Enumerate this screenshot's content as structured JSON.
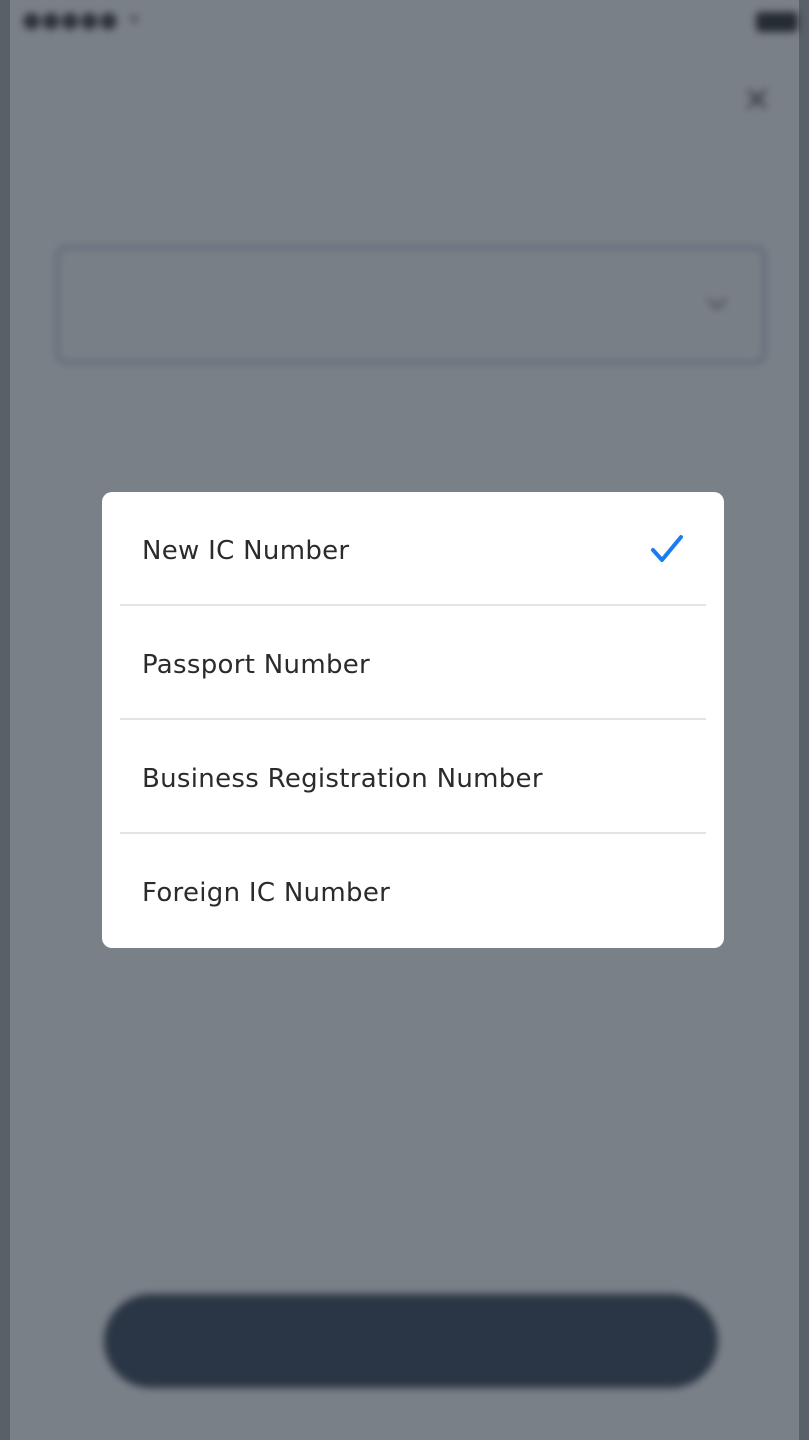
{
  "status_bar": {
    "carrier": "●●●●● ⚬",
    "time": "",
    "battery": ""
  },
  "header": {
    "title": "",
    "subtitle": "",
    "close_icon": "close-icon"
  },
  "form": {
    "id_type_label": "",
    "id_number_label": "",
    "next_button_label": ""
  },
  "picker": {
    "selected_index": 0,
    "check_color": "#1a7cf2",
    "options": [
      {
        "label": "New IC Number",
        "selected": true
      },
      {
        "label": "Passport Number",
        "selected": false
      },
      {
        "label": "Business Registration Number",
        "selected": false
      },
      {
        "label": "Foreign IC Number",
        "selected": false
      }
    ]
  }
}
